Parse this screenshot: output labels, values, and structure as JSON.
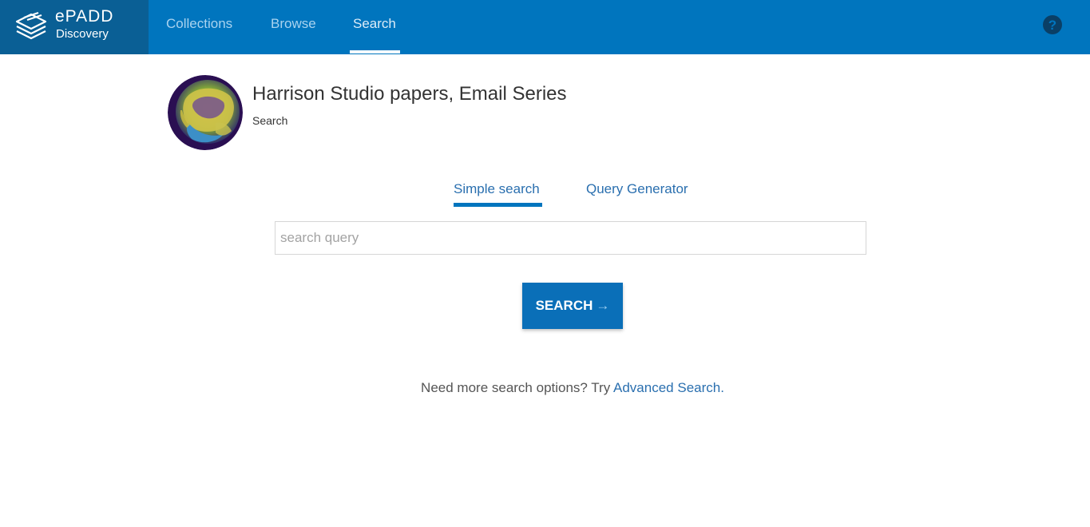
{
  "brand": {
    "name": "ePADD",
    "subtitle": "Discovery"
  },
  "nav": {
    "items": [
      {
        "label": "Collections"
      },
      {
        "label": "Browse"
      },
      {
        "label": "Search",
        "active": true
      }
    ],
    "help_icon": "question-circle-icon"
  },
  "collection": {
    "title": "Harrison Studio papers, Email Series",
    "subtitle": "Search",
    "image": "globe-image"
  },
  "tabs": [
    {
      "label": "Simple search",
      "active": true
    },
    {
      "label": "Query Generator",
      "active": false
    }
  ],
  "search": {
    "placeholder": "search query",
    "value": "",
    "button_label": "SEARCH",
    "button_icon": "arrow-right-icon"
  },
  "footer_hint": {
    "text": "Need more search options? Try ",
    "link": "Advanced Search",
    "suffix": "."
  },
  "colors": {
    "topbar": "#0075be",
    "brand_bg": "#0a5f95",
    "accent": "#0075be",
    "link": "#2a6faf",
    "button": "#0a6fb8"
  }
}
